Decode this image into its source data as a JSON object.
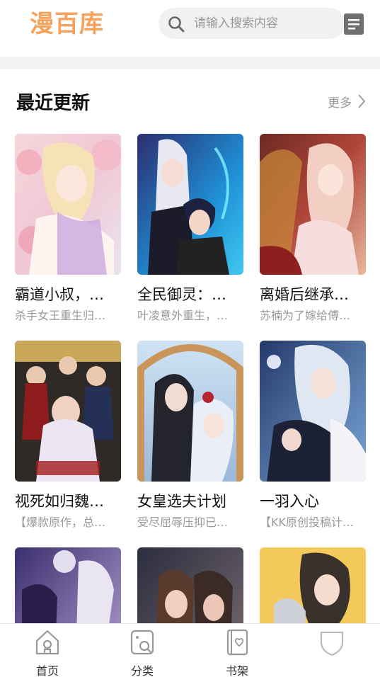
{
  "header": {
    "logo": "漫百库",
    "search": {
      "placeholder": "请输入搜索内容"
    }
  },
  "section": {
    "title": "最近更新",
    "more_label": "更多"
  },
  "comics": [
    {
      "title": "霸道小叔，…",
      "desc": "杀手女王重生归…"
    },
    {
      "title": "全民御灵：…",
      "desc": "叶凌意外重生，…"
    },
    {
      "title": "离婚后继承…",
      "desc": "苏楠为了嫁给傅…"
    },
    {
      "title": "视死如归魏…",
      "desc": "【爆款原作，总…"
    },
    {
      "title": "女皇选夫计划",
      "desc": "受尽屈辱压抑已…"
    },
    {
      "title": "一羽入心",
      "desc": "【KK原创投稿计…"
    },
    {
      "title": "",
      "desc": ""
    },
    {
      "title": "",
      "desc": ""
    },
    {
      "title": "",
      "desc": ""
    }
  ],
  "bottom_nav": [
    {
      "label": "首页",
      "icon": "home-icon"
    },
    {
      "label": "分类",
      "icon": "category-icon"
    },
    {
      "label": "书架",
      "icon": "bookshelf-icon"
    },
    {
      "label": "",
      "icon": "profile-icon"
    }
  ],
  "colors": {
    "logo": "#f7a25c",
    "accent": "#f7a25c"
  }
}
